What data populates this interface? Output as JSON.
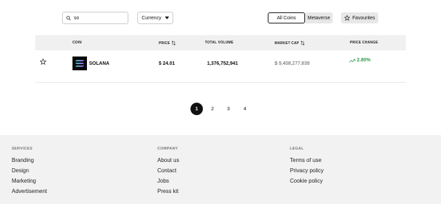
{
  "search": {
    "value": "so",
    "placeholder": "Search"
  },
  "filters": {
    "currency_label": "Currency",
    "all_coins": "All Coins",
    "metaverse": "Metaverse",
    "favourites": "Favourites"
  },
  "table": {
    "columns": [
      "COIN",
      "PRICE",
      "TOTAL VOLUME",
      "MARKET CAP",
      "PRICE CHANGE"
    ],
    "rows": [
      {
        "coin": "SOLANA",
        "price": "$ 24.01",
        "volume": "1,376,752,941",
        "market_cap": "$ 9,408,277,839",
        "change": "2.80%"
      }
    ]
  },
  "pagination": {
    "pages": [
      "1",
      "2",
      "3",
      "4"
    ],
    "current": "1"
  },
  "footer": {
    "services": {
      "title": "SERVICES",
      "links": [
        "Branding",
        "Design",
        "Marketing",
        "Advertisement"
      ]
    },
    "company": {
      "title": "COMPANY",
      "links": [
        "About us",
        "Contact",
        "Jobs",
        "Press kit"
      ]
    },
    "legal": {
      "title": "LEGAL",
      "links": [
        "Terms of use",
        "Privacy policy",
        "Cookie policy"
      ]
    }
  },
  "colors": {
    "positive": "#2a9d4a",
    "active_page": "#111111",
    "footer_bg": "#f2f2f2"
  },
  "icons": {
    "search": "search-icon",
    "caret": "caret-down-icon",
    "star": "star-icon",
    "sort": "sort-icon",
    "trend": "trending-up-icon",
    "coin": "solana-logo-icon"
  }
}
